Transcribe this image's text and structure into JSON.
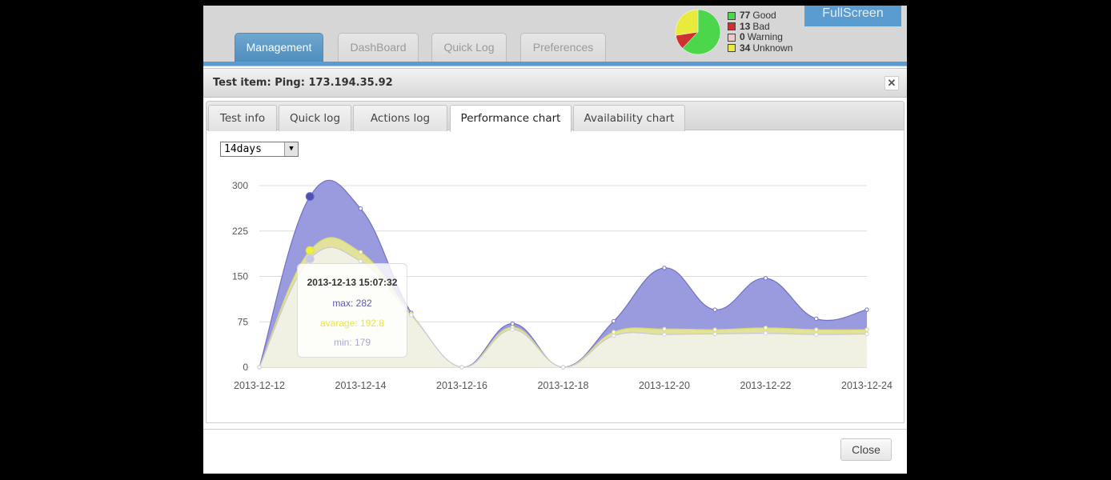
{
  "nav": {
    "tabs": [
      {
        "label": "Management",
        "active": true
      },
      {
        "label": "DashBoard",
        "active": false
      },
      {
        "label": "Quick Log",
        "active": false
      },
      {
        "label": "Preferences",
        "active": false
      }
    ]
  },
  "status": {
    "items": [
      {
        "count": "77",
        "label": "Good",
        "color": "#4cd64c"
      },
      {
        "count": "13",
        "label": "Bad",
        "color": "#d03030"
      },
      {
        "count": "0",
        "label": "Warning",
        "color": "#f0c8c8"
      },
      {
        "count": "34",
        "label": "Unknown",
        "color": "#eaea3c"
      }
    ],
    "fullscreen_label": "FullScreen"
  },
  "dialog": {
    "title": "Test item: Ping: 173.194.35.92",
    "close_icon": "close-icon",
    "tabs": [
      {
        "label": "Test info",
        "active": false
      },
      {
        "label": "Quick log",
        "active": false
      },
      {
        "label": "Actions log",
        "active": false
      },
      {
        "label": "Performance chart",
        "active": true
      },
      {
        "label": "Availability chart",
        "active": false
      }
    ],
    "range": "14days",
    "close_button": "Close"
  },
  "tooltip": {
    "date": "2013-12-13 15:07:32",
    "max": "max: 282",
    "avg": "avarage: 192.8",
    "min": "min: 179"
  },
  "chart_data": {
    "type": "area",
    "yticks": [
      0,
      75,
      150,
      225,
      300
    ],
    "ylim": [
      0,
      300
    ],
    "x_tick_labels": [
      "2013-12-12",
      "2013-12-14",
      "2013-12-16",
      "2013-12-18",
      "2013-12-20",
      "2013-12-22",
      "2013-12-24"
    ],
    "x": [
      "2013-12-12",
      "2013-12-13",
      "2013-12-14",
      "2013-12-15",
      "2013-12-16",
      "2013-12-17",
      "2013-12-18",
      "2013-12-19",
      "2013-12-20",
      "2013-12-21",
      "2013-12-22",
      "2013-12-23",
      "2013-12-24"
    ],
    "series": [
      {
        "name": "max",
        "color": "#9a9ade",
        "line": "#7070c8",
        "values": [
          0,
          282,
          262,
          90,
          0,
          72,
          0,
          76,
          164,
          95,
          147,
          80,
          95
        ]
      },
      {
        "name": "avarage",
        "color": "#e2e29a",
        "line": "#d8d870",
        "values": [
          0,
          192.8,
          190,
          88,
          0,
          66,
          0,
          58,
          63,
          62,
          65,
          62,
          62
        ]
      },
      {
        "name": "min",
        "color": "#f1f1e3",
        "line": "#c8c8d8",
        "values": [
          0,
          179,
          175,
          86,
          0,
          62,
          0,
          52,
          54,
          55,
          56,
          54,
          55
        ]
      }
    ]
  }
}
